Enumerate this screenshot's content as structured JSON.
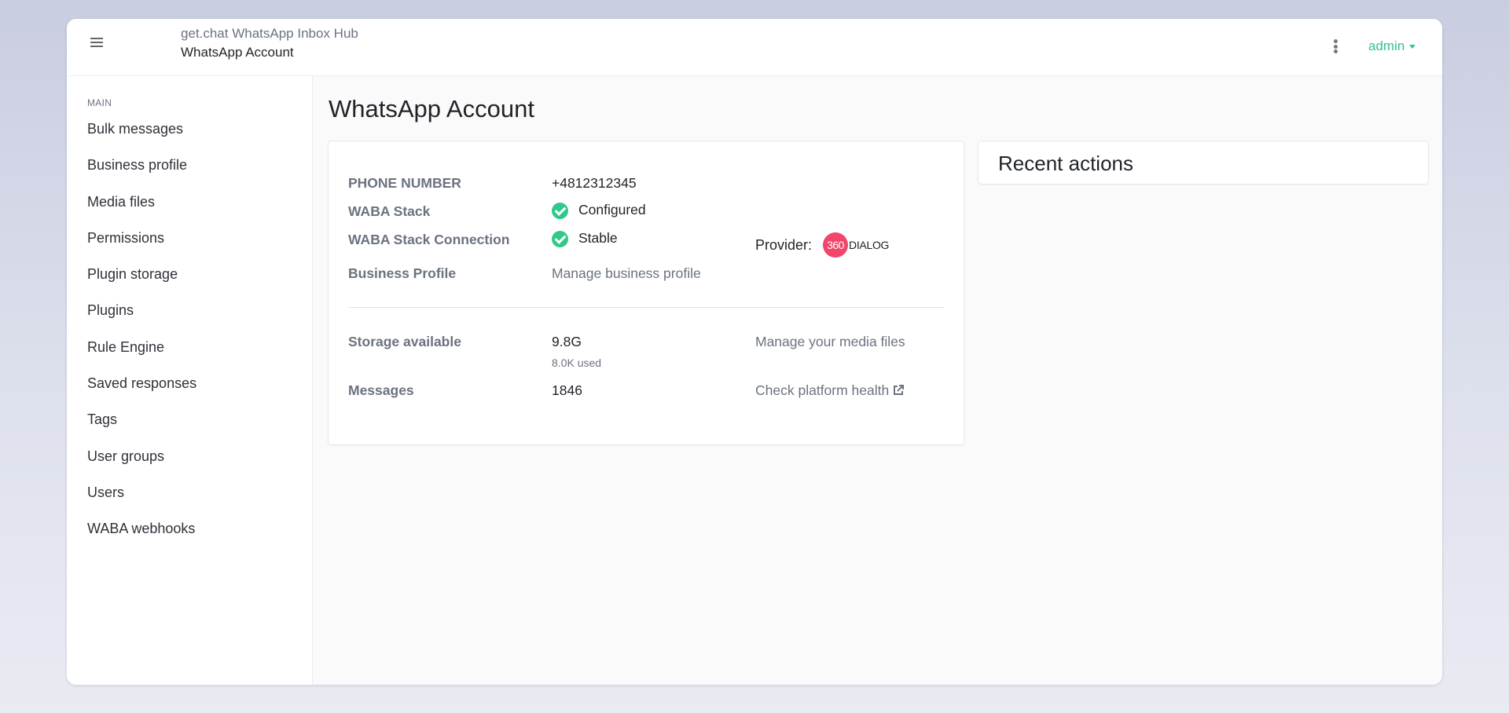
{
  "header": {
    "app_title": "get.chat WhatsApp Inbox Hub",
    "page_crumb": "WhatsApp Account",
    "user_menu_label": "admin"
  },
  "sidebar": {
    "heading": "MAIN",
    "items": [
      {
        "label": "Bulk messages"
      },
      {
        "label": "Business profile"
      },
      {
        "label": "Media files"
      },
      {
        "label": "Permissions"
      },
      {
        "label": "Plugin storage"
      },
      {
        "label": "Plugins"
      },
      {
        "label": "Rule Engine"
      },
      {
        "label": "Saved responses"
      },
      {
        "label": "Tags"
      },
      {
        "label": "User groups"
      },
      {
        "label": "Users"
      },
      {
        "label": "WABA webhooks"
      }
    ]
  },
  "main": {
    "title": "WhatsApp Account",
    "account": {
      "phone_label": "PHONE NUMBER",
      "phone_value": "+4812312345",
      "stack_label": "WABA Stack",
      "stack_value": "Configured",
      "connection_label": "WABA Stack Connection",
      "connection_value": "Stable",
      "provider_label": "Provider:",
      "provider_logo_number": "360",
      "provider_logo_text": "DIALOG",
      "business_profile_label": "Business Profile",
      "business_profile_link": "Manage business profile",
      "storage_label": "Storage available",
      "storage_value": "9.8G",
      "storage_used": "8.0K used",
      "media_link": "Manage your media files",
      "messages_label": "Messages",
      "messages_value": "1846",
      "health_link": "Check platform health"
    },
    "recent_actions_title": "Recent actions"
  },
  "colors": {
    "accent": "#34c48d",
    "status_ok": "#2fc98b",
    "provider_brand": "#f2456b"
  }
}
